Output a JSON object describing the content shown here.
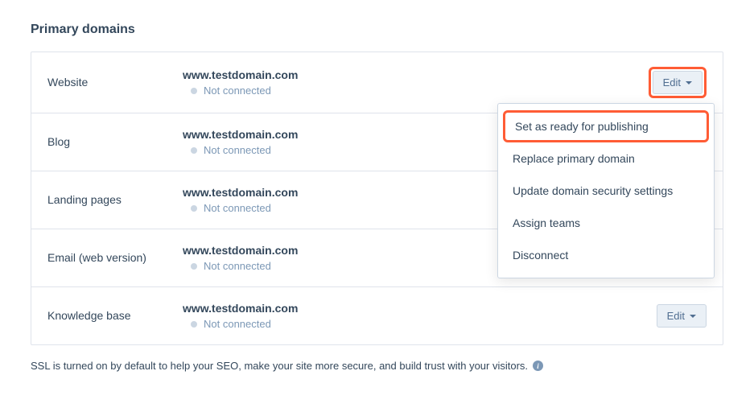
{
  "section_title": "Primary domains",
  "edit_label": "Edit",
  "rows": [
    {
      "type": "Website",
      "domain": "www.testdomain.com",
      "status": "Not connected"
    },
    {
      "type": "Blog",
      "domain": "www.testdomain.com",
      "status": "Not connected"
    },
    {
      "type": "Landing pages",
      "domain": "www.testdomain.com",
      "status": "Not connected"
    },
    {
      "type": "Email (web version)",
      "domain": "www.testdomain.com",
      "status": "Not connected"
    },
    {
      "type": "Knowledge base",
      "domain": "www.testdomain.com",
      "status": "Not connected"
    }
  ],
  "dropdown": {
    "items": [
      "Set as ready for publishing",
      "Replace primary domain",
      "Update domain security settings",
      "Assign teams",
      "Disconnect"
    ]
  },
  "ssl_note": "SSL is turned on by default to help your SEO, make your site more secure, and build trust with your visitors."
}
